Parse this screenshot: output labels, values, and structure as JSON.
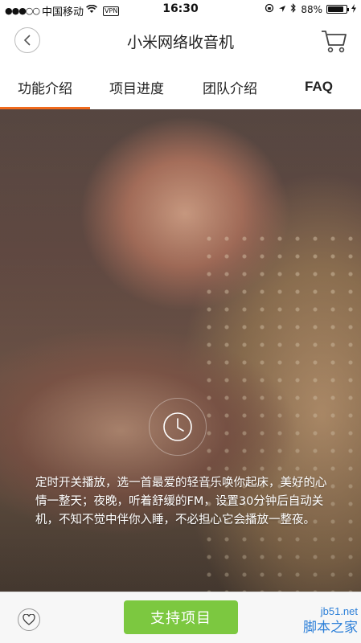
{
  "status_bar": {
    "signal": "●●●○○",
    "carrier": "中国移动",
    "vpn": "VPN",
    "time": "16:30",
    "battery_percent_label": "88%",
    "battery_level": 0.88
  },
  "nav": {
    "title": "小米网络收音机",
    "back_icon": "back-chevron-icon",
    "cart_icon": "cart-icon"
  },
  "tabs": [
    {
      "label": "功能介绍",
      "active": true
    },
    {
      "label": "项目进度",
      "active": false
    },
    {
      "label": "团队介绍",
      "active": false
    },
    {
      "label": "FAQ",
      "active": false
    }
  ],
  "hero": {
    "icon": "clock-icon",
    "text": "定时开关播放，选一首最爱的轻音乐唤你起床，美好的心情一整天；夜晚，听着舒缓的FM，设置30分钟后自动关机，不知不觉中伴你入睡，不必担心它会播放一整夜。"
  },
  "bottom": {
    "like_icon": "heart-icon",
    "support_label": "支持项目",
    "accent_color": "#7cc840"
  },
  "watermark": {
    "url": "jb51.net",
    "name": "脚本之家"
  },
  "colors": {
    "tab_indicator": "#f06a1d"
  }
}
